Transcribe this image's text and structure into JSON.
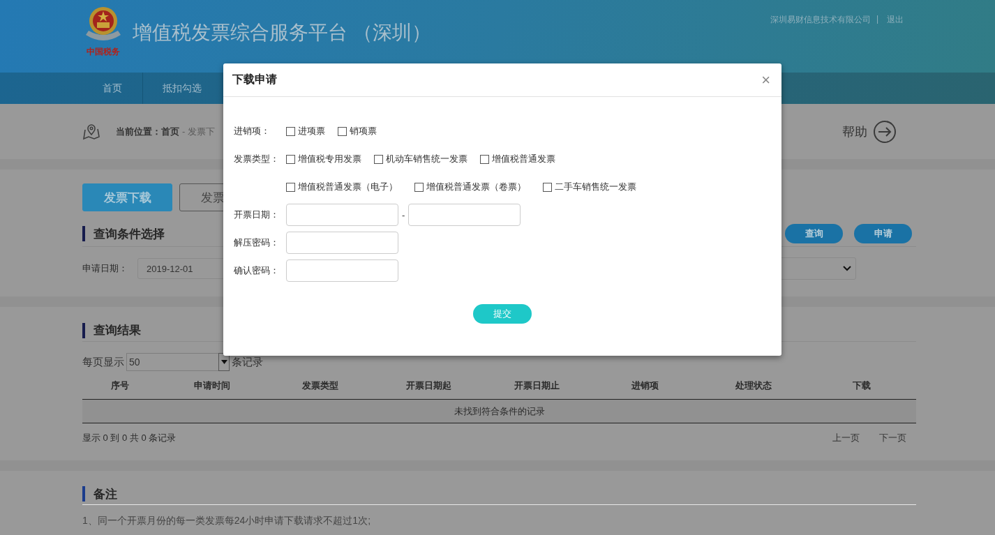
{
  "header": {
    "logo_caption": "中国税务",
    "title": "增值税发票综合服务平台 （深圳）",
    "company": "深圳易财信息技术有限公司",
    "divider": "|",
    "logout": "退出"
  },
  "nav": [
    {
      "label": "首页"
    },
    {
      "label": "抵扣勾选"
    }
  ],
  "breadcrumb": {
    "label": "当前位置：",
    "items": [
      {
        "label": "首页",
        "current": false
      },
      {
        "label": "发票下",
        "current": true
      }
    ],
    "separator": "-",
    "help": "帮助"
  },
  "tabs": [
    {
      "label": "发票下载",
      "selected": true
    },
    {
      "label": "发票",
      "selected": false
    }
  ],
  "query": {
    "title": "查询条件选择",
    "date_label": "申请日期：",
    "date_value": "2019-12-01",
    "buttons": [
      "查询",
      "申请"
    ]
  },
  "results": {
    "title": "查询结果",
    "page_size_label": "每页显示",
    "page_size": "50",
    "page_size_suffix": "条记录",
    "columns": [
      "序号",
      "申请时间",
      "发票类型",
      "开票日期起",
      "开票日期止",
      "进销项",
      "处理状态",
      "下载"
    ],
    "empty": "未找到符合条件的记录",
    "summary": "显示 0 到 0 共 0 条记录",
    "prev": "上一页",
    "next": "下一页"
  },
  "notes": {
    "title": "备注",
    "items": [
      "1、同一个开票月份的每一类发票每24小时申请下载请求不超过1次;"
    ]
  },
  "dialog": {
    "title": "下载申请",
    "close": "×",
    "checkbox_rows": [
      {
        "label": "进销项：",
        "options": [
          {
            "label": "进项票",
            "checked": false
          },
          {
            "label": "销项票",
            "checked": false
          }
        ]
      },
      {
        "label": "发票类型：",
        "options": [
          {
            "label": "增值税专用发票",
            "checked": false
          },
          {
            "label": "机动车销售统一发票",
            "checked": false
          },
          {
            "label": "增值税普通发票",
            "checked": false
          }
        ]
      },
      {
        "label": "",
        "options": [
          {
            "label": "增值税普通发票（电子）",
            "checked": false
          },
          {
            "label": "增值税普通发票（卷票）",
            "checked": false
          },
          {
            "label": "二手车销售统一发票",
            "checked": false
          }
        ]
      }
    ],
    "date_label": "开票日期：",
    "date_separator": "-",
    "unzip_label": "解压密码：",
    "confirm_label": "确认密码：",
    "submit": "提交"
  }
}
